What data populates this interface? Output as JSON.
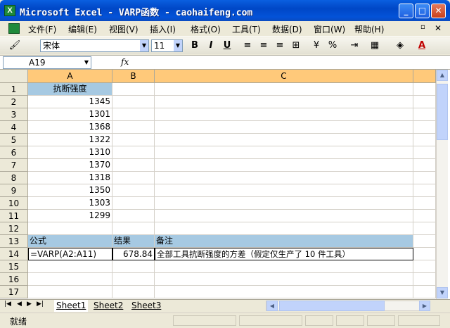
{
  "window": {
    "title": "Microsoft Excel - VARP函数 - caohaifeng.com"
  },
  "menu": [
    "文件(F)",
    "编辑(E)",
    "视图(V)",
    "插入(I)",
    "格式(O)",
    "工具(T)",
    "数据(D)",
    "窗口(W)",
    "帮助(H)"
  ],
  "toolbar": {
    "font": "宋体",
    "size": "11",
    "bold": "B",
    "italic": "I",
    "underline": "U",
    "percent": "%"
  },
  "formula_bar": {
    "name_box": "A19",
    "fx": "fx"
  },
  "columns": [
    "A",
    "B",
    "C"
  ],
  "rows": [
    "1",
    "2",
    "3",
    "4",
    "5",
    "6",
    "7",
    "8",
    "9",
    "10",
    "11",
    "12",
    "13",
    "14",
    "15",
    "16",
    "17"
  ],
  "cells": {
    "A1": "抗断强度",
    "A2": "1345",
    "A3": "1301",
    "A4": "1368",
    "A5": "1322",
    "A6": "1310",
    "A7": "1370",
    "A8": "1318",
    "A9": "1350",
    "A10": "1303",
    "A11": "1299",
    "A13": "公式",
    "B13": "结果",
    "C13": "备注",
    "A14": "=VARP(A2:A11)",
    "B14": "678.84",
    "C14": "全部工具抗断强度的方差（假定仅生产了 10 件工具）"
  },
  "sheets": [
    "Sheet1",
    "Sheet2",
    "Sheet3"
  ],
  "status": "就绪",
  "colors": {
    "header_fill": "#a6c9e2",
    "col_header_active": "#ffc97a",
    "title_blue": "#0352d8"
  }
}
